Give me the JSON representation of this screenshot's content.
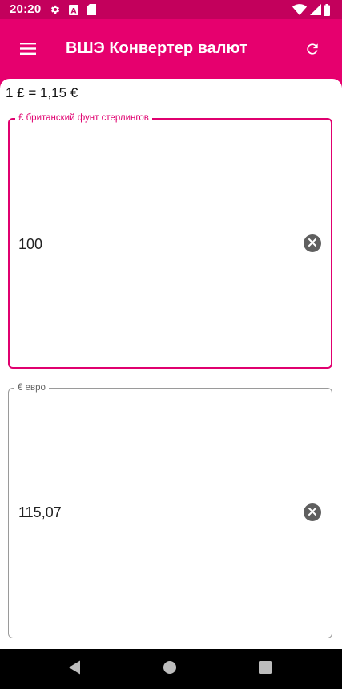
{
  "status_bar": {
    "time": "20:20",
    "icons": [
      "gear-icon",
      "font-a-icon",
      "sd-card-icon",
      "wifi-icon",
      "signal-icon",
      "battery-icon"
    ],
    "color": "#c3005c"
  },
  "app_bar": {
    "title": "ВШЭ Конвертер валют",
    "menu_icon": "hamburger-menu-icon",
    "refresh_icon": "refresh-icon",
    "color": "#e6006e"
  },
  "converter": {
    "rate_text": "1 £ = 1,15 €",
    "from": {
      "label": "£ британский фунт стерлингов",
      "value": "100",
      "clear_icon": "clear-circle-icon",
      "accent": "#e0006f"
    },
    "to": {
      "label": "€ евро",
      "value": "115,07",
      "clear_icon": "clear-circle-icon"
    }
  },
  "nav_bar": {
    "back_icon": "back-triangle-icon",
    "home_icon": "home-circle-icon",
    "recents_icon": "recents-square-icon"
  }
}
